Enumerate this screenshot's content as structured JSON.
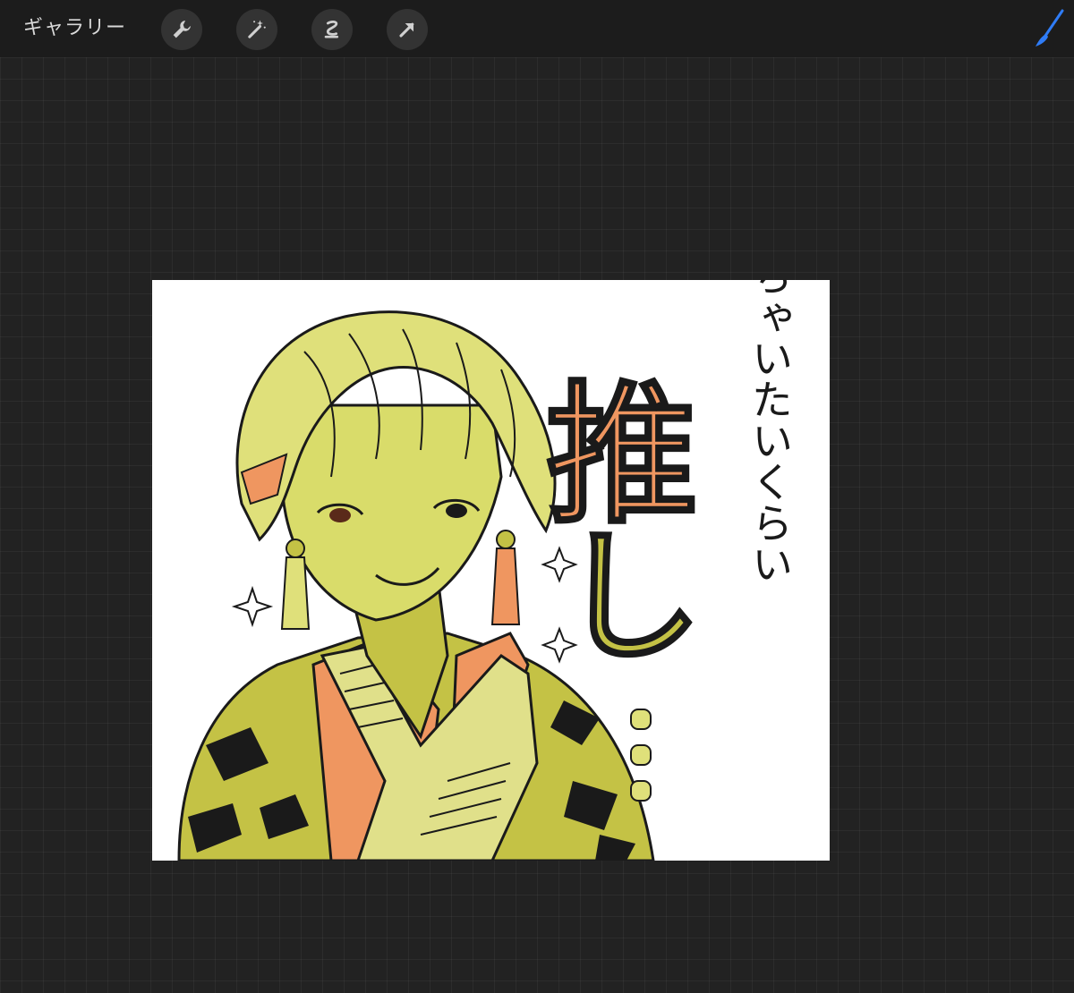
{
  "toolbar": {
    "gallery_label": "ギャラリー",
    "tools": [
      {
        "name": "wrench-icon",
        "label": "Actions"
      },
      {
        "name": "magic-wand-icon",
        "label": "Adjustments"
      },
      {
        "name": "selection-icon",
        "label": "Selection"
      },
      {
        "name": "transform-arrow-icon",
        "label": "Transform"
      }
    ],
    "brush_color": "#2f7cf6"
  },
  "canvas": {
    "artwork": {
      "main_text": "推し",
      "dots": "…",
      "vertical_text": "食べちゃいたいくらい"
    },
    "colors": {
      "hair": "#dfe07a",
      "skin": "#d9dc6a",
      "accent_orange": "#ef9660",
      "kimono_olive": "#c4c245",
      "line": "#1a1a1a"
    }
  }
}
